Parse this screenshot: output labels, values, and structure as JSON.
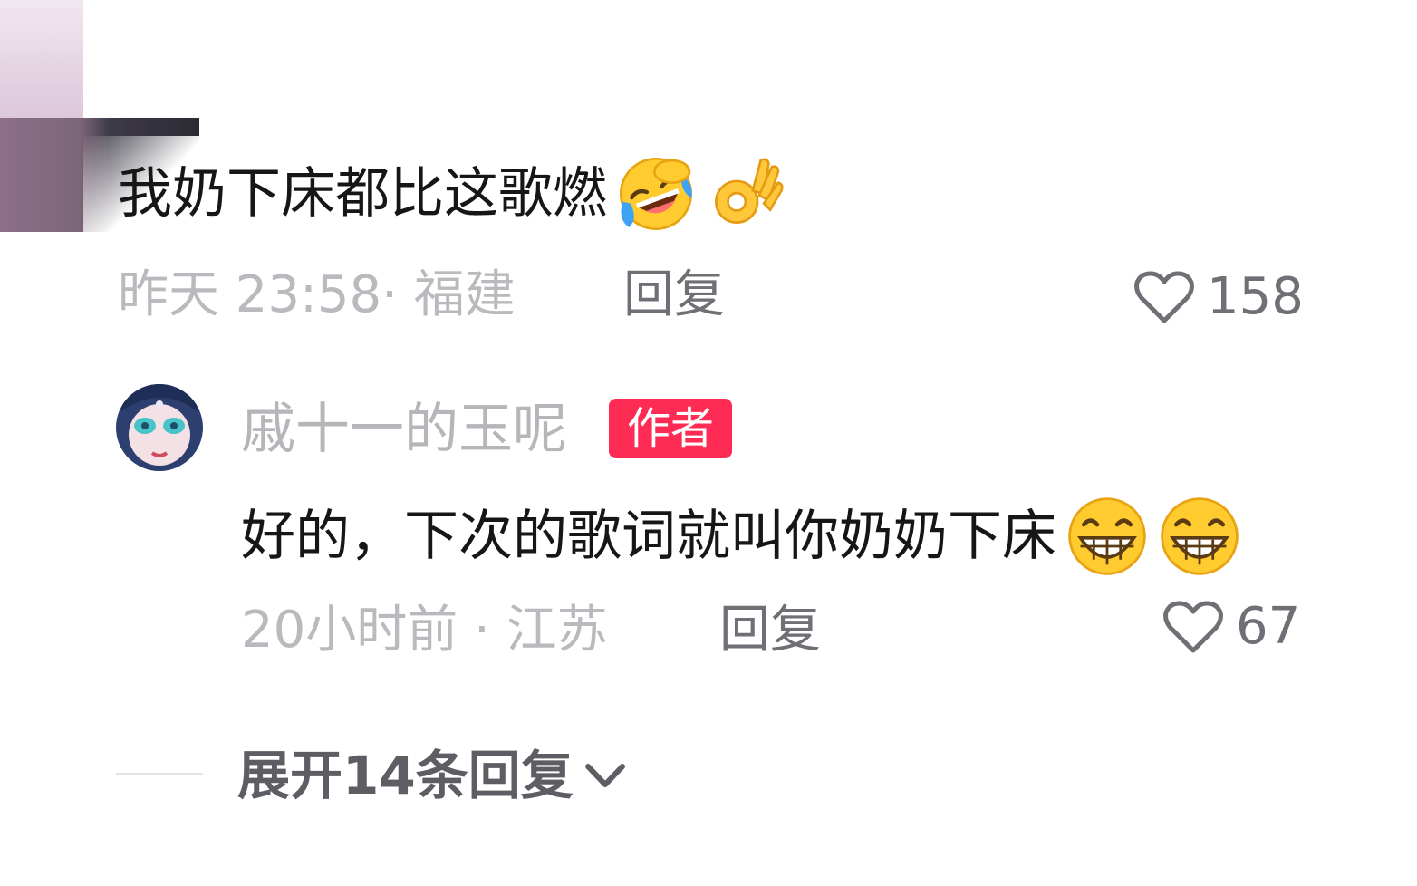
{
  "top_comment": {
    "text": "我奶下床都比这歌燃",
    "emojis": [
      "rolling-laughing-emoji",
      "ok-hand-emoji"
    ],
    "time": "昨天 23:58· 福建",
    "reply_label": "回复",
    "likes": "158"
  },
  "reply": {
    "username": "戚十一的玉呢",
    "badge": "作者",
    "text": "好的，下次的歌词就叫你奶奶下床",
    "emojis": [
      "grinning-emoji",
      "grinning-emoji"
    ],
    "time": "20小时前 · 江苏",
    "reply_label": "回复",
    "likes": "67"
  },
  "expand_label": "展开14条回复",
  "colors": {
    "badge": "#fe2c55",
    "text": "#161616",
    "meta": "#b9b9be"
  }
}
